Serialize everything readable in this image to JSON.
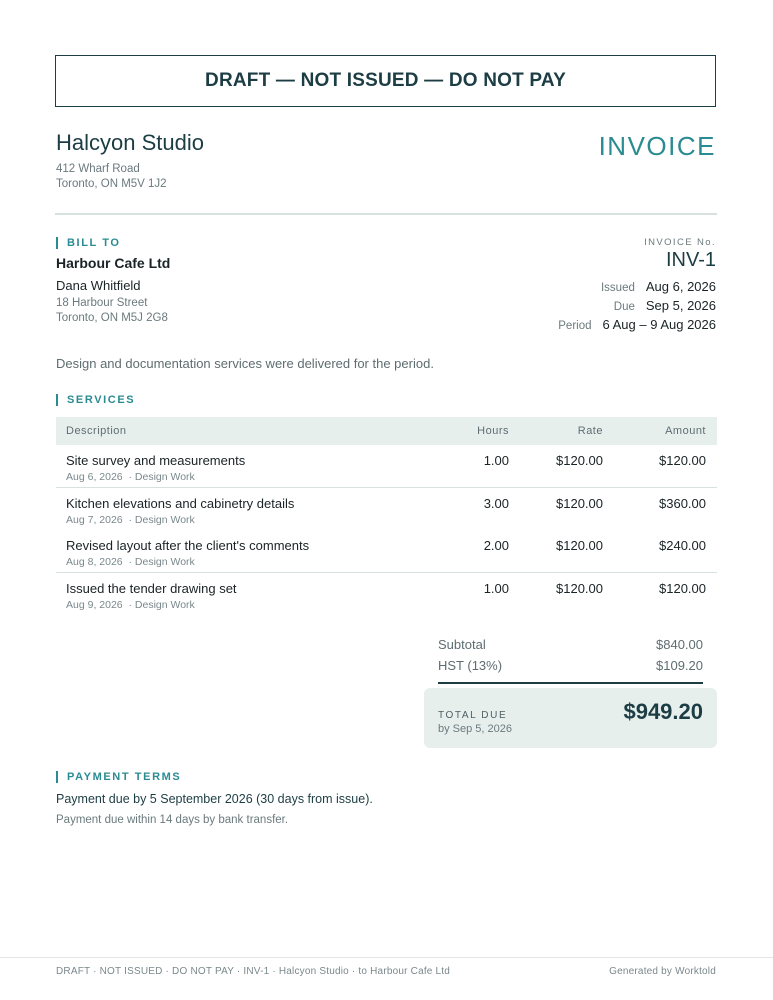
{
  "banner": "DRAFT — NOT ISSUED — DO NOT PAY",
  "company": {
    "name": "Halcyon Studio",
    "address_line1": "412 Wharf Road",
    "address_line2": "Toronto, ON M5V 1J2"
  },
  "document_title": "INVOICE",
  "bill_to": {
    "label": "BILL TO",
    "company": "Harbour Cafe Ltd",
    "contact": "Dana Whitfield",
    "address_line1": "18 Harbour Street",
    "address_line2": "Toronto, ON M5J 2G8"
  },
  "invoice_meta": {
    "number_label": "INVOICE No.",
    "number": "INV-1",
    "issued_label": "Issued",
    "issued": "Aug 6, 2026",
    "due_label": "Due",
    "due": "Sep 5, 2026",
    "period_label": "Period",
    "period": "6 Aug – 9 Aug 2026"
  },
  "note": "Design and documentation services were delivered for the period.",
  "services": {
    "label": "SERVICES",
    "columns": {
      "description": "Description",
      "hours": "Hours",
      "rate": "Rate",
      "amount": "Amount"
    },
    "rows": [
      {
        "title": "Site survey and measurements",
        "date": "Aug 6, 2026",
        "category": "· Design Work",
        "hours": "1.00",
        "rate": "$120.00",
        "amount": "$120.00"
      },
      {
        "title": "Kitchen elevations and cabinetry details",
        "date": "Aug 7, 2026",
        "category": "· Design Work",
        "hours": "3.00",
        "rate": "$120.00",
        "amount": "$360.00"
      },
      {
        "title": "Revised layout after the client's comments",
        "date": "Aug 8, 2026",
        "category": "· Design Work",
        "hours": "2.00",
        "rate": "$120.00",
        "amount": "$240.00"
      },
      {
        "title": "Issued the tender drawing set",
        "date": "Aug 9, 2026",
        "category": "· Design Work",
        "hours": "1.00",
        "rate": "$120.00",
        "amount": "$120.00"
      }
    ]
  },
  "totals": {
    "subtotal_label": "Subtotal",
    "subtotal": "$840.00",
    "tax_label": "HST (13%)",
    "tax": "$109.20",
    "total_label": "TOTAL DUE",
    "total_by": "by Sep 5, 2026",
    "total": "$949.20"
  },
  "payment_terms": {
    "label": "PAYMENT TERMS",
    "main": "Payment due by 5 September 2026 (30 days from issue).",
    "sub": "Payment due within 14 days by bank transfer."
  },
  "footer": {
    "left": "DRAFT · NOT ISSUED · DO NOT PAY · INV-1 · Halcyon Studio · to Harbour Cafe Ltd",
    "right": "Generated by Worktold"
  },
  "colors": {
    "accent": "#2a8b92",
    "ink": "#1d3d44",
    "table_header_bg": "#e7efed"
  }
}
